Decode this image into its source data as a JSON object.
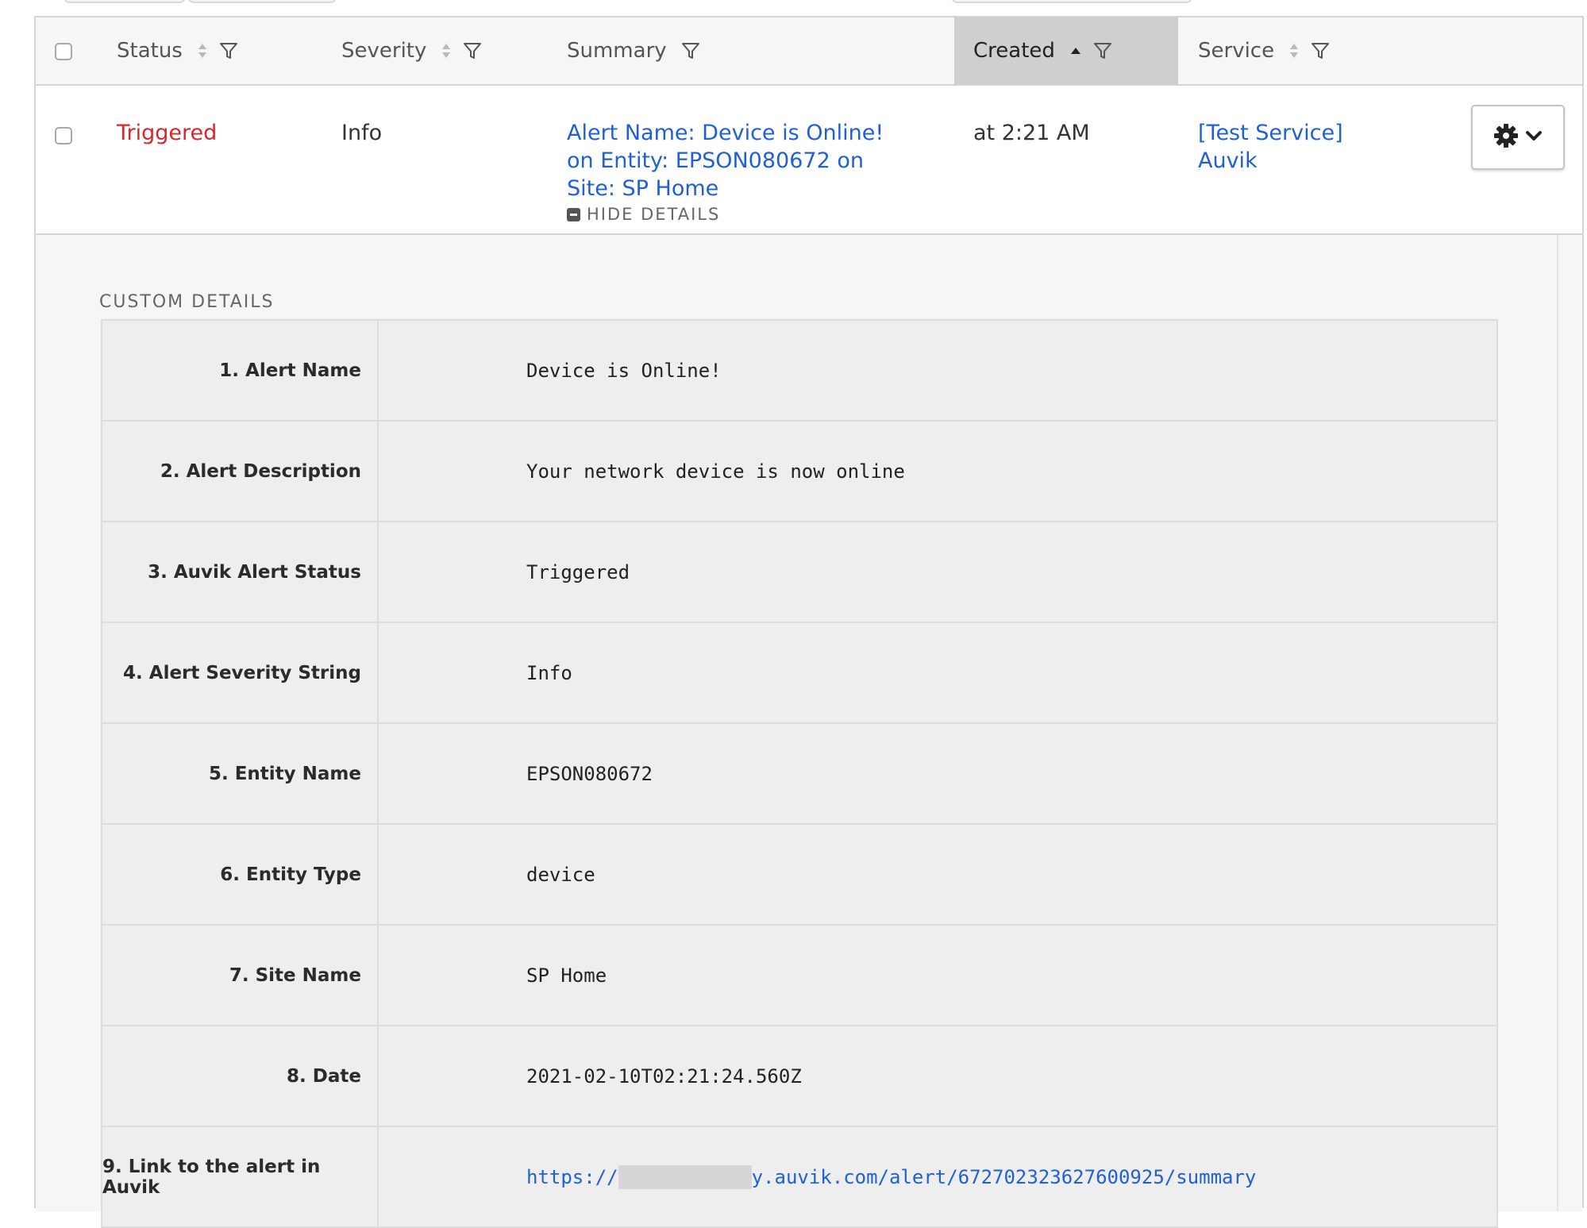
{
  "table": {
    "columns": [
      {
        "label": "Status"
      },
      {
        "label": "Severity"
      },
      {
        "label": "Summary"
      },
      {
        "label": "Created"
      },
      {
        "label": "Service"
      }
    ]
  },
  "incident": {
    "status": "Triggered",
    "severity": "Info",
    "summary": "Alert Name: Device is Online! on Entity: EPSON080672 on Site: SP Home",
    "hide_details_label": "HIDE DETAILS",
    "created": "at 2:21 AM",
    "service_line1": "[Test Service]",
    "service_line2": "Auvik"
  },
  "custom_details": {
    "title": "CUSTOM DETAILS",
    "rows": [
      {
        "key": "1. Alert Name",
        "value": "Device is Online!"
      },
      {
        "key": "2. Alert Description",
        "value": "Your network device is now online"
      },
      {
        "key": "3. Auvik Alert Status",
        "value": "Triggered"
      },
      {
        "key": "4. Alert Severity String",
        "value": "Info"
      },
      {
        "key": "5. Entity Name",
        "value": "EPSON080672"
      },
      {
        "key": "6. Entity Type",
        "value": "device"
      },
      {
        "key": "7. Site Name",
        "value": "SP Home"
      },
      {
        "key": "8. Date",
        "value": "2021-02-10T02:21:24.560Z"
      },
      {
        "key": "9. Link to the alert in Auvik",
        "value_prefix": "https://",
        "value_suffix": "y.auvik.com/alert/672702323627600925/summary"
      }
    ]
  },
  "colors": {
    "triggered": "#d9262d",
    "link": "#1f5fd8",
    "active_header": "#cfcfcf"
  }
}
